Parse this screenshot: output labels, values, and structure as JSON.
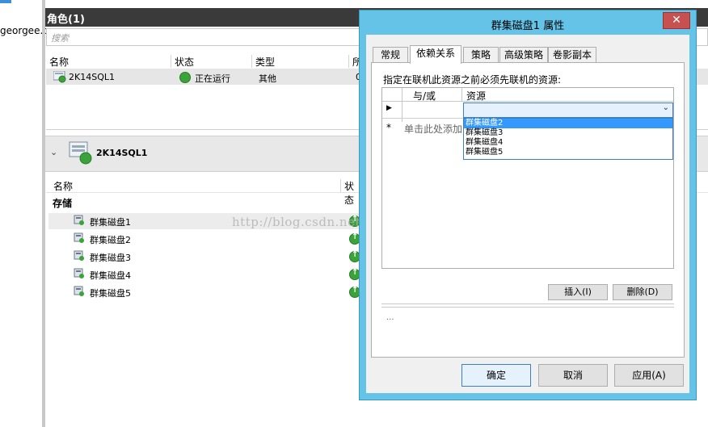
{
  "left_pane": {
    "truncated_text": "georgee.c"
  },
  "roles": {
    "header": "角色(1)",
    "search_placeholder": "搜索",
    "columns": [
      "名称",
      "状态",
      "类型",
      "所"
    ],
    "row": {
      "name": "2K14SQL1",
      "status": "正在运行",
      "type": "其他",
      "extra": "0"
    }
  },
  "detail": {
    "title": "2K14SQL1",
    "columns": [
      "名称",
      "状态"
    ],
    "group": "存储",
    "disks": [
      "群集磁盘1",
      "群集磁盘2",
      "群集磁盘3",
      "群集磁盘4",
      "群集磁盘5"
    ]
  },
  "watermark": "http://blog.csdn.net/DBA_Huangzj",
  "dialog": {
    "title": "群集磁盘1 属性",
    "close": "✕",
    "tabs": [
      "常规",
      "依赖关系",
      "策略",
      "高级策略",
      "卷影副本"
    ],
    "prompt": "指定在联机此资源之前必须先联机的资源:",
    "grid_headers": [
      "与/或",
      "资源"
    ],
    "row_marker": "▶",
    "new_marker": "*",
    "add_hint": "单击此处添加",
    "options": [
      "群集磁盘2",
      "群集磁盘3",
      "群集磁盘4",
      "群集磁盘5"
    ],
    "insert": "插入(I)",
    "delete": "删除(D)",
    "ellipsis": "...",
    "ok": "确定",
    "cancel": "取消",
    "apply": "应用(A)"
  }
}
